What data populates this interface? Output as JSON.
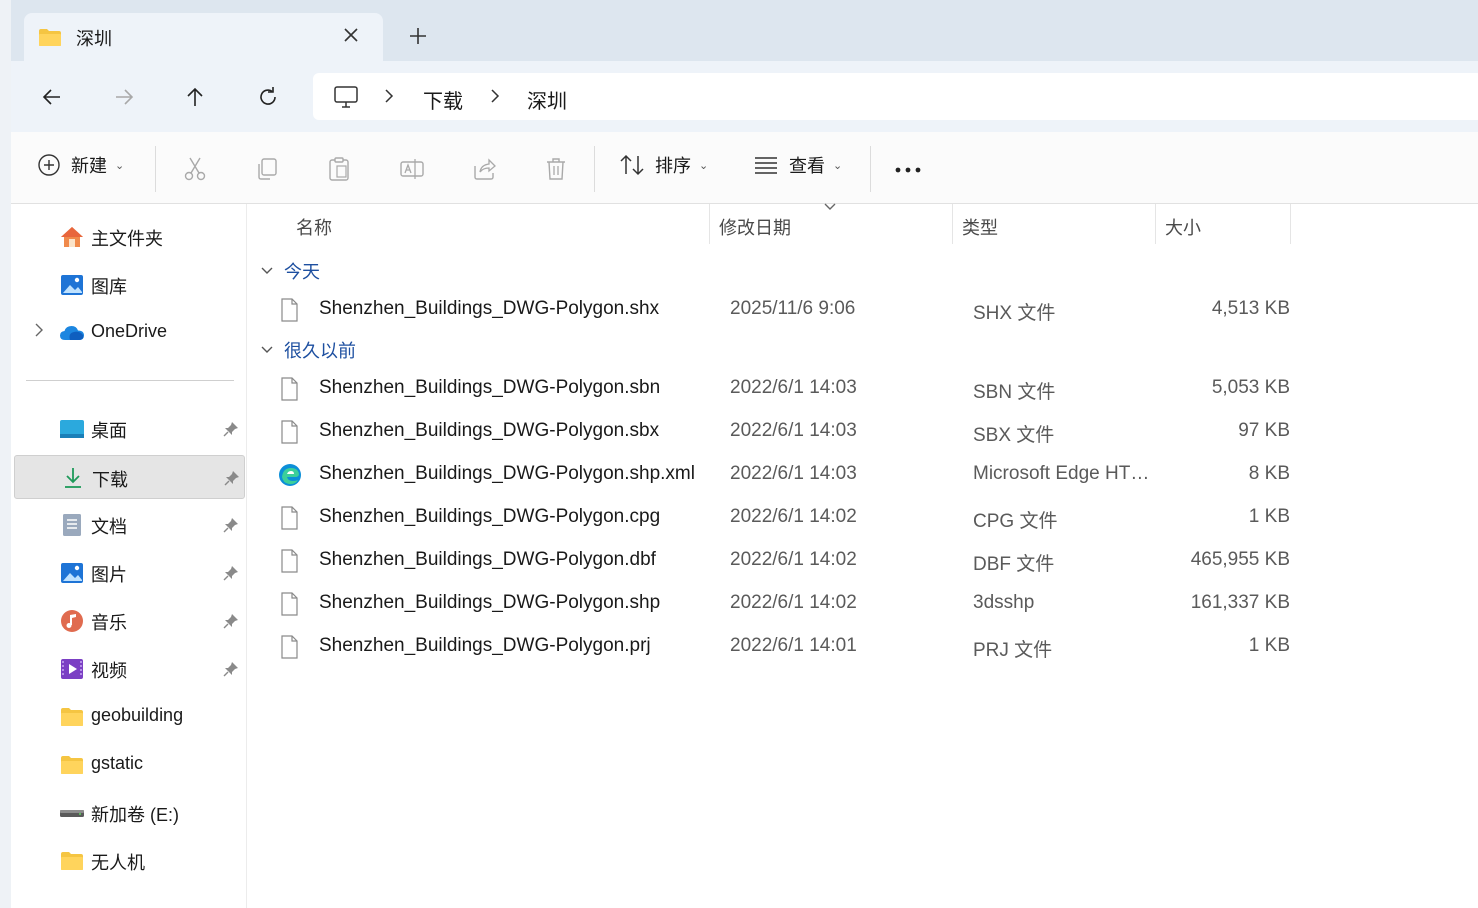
{
  "tab": {
    "title": "深圳",
    "close_icon": "close-icon",
    "new_tab_icon": "plus-icon"
  },
  "nav": {
    "breadcrumb": [
      "下载",
      "深圳"
    ]
  },
  "toolbar": {
    "new_label": "新建",
    "sort_label": "排序",
    "view_label": "查看"
  },
  "sidebar": {
    "items": [
      {
        "label": "主文件夹",
        "icon": "home-icon"
      },
      {
        "label": "图库",
        "icon": "gallery-icon"
      },
      {
        "label": "OneDrive",
        "icon": "cloud-icon"
      },
      {
        "label": "桌面",
        "icon": "desktop-icon"
      },
      {
        "label": "下载",
        "icon": "download-icon"
      },
      {
        "label": "文档",
        "icon": "document-icon"
      },
      {
        "label": "图片",
        "icon": "pictures-icon"
      },
      {
        "label": "音乐",
        "icon": "music-icon"
      },
      {
        "label": "视频",
        "icon": "video-icon"
      },
      {
        "label": "geobuilding",
        "icon": "folder-icon"
      },
      {
        "label": "gstatic",
        "icon": "folder-icon"
      },
      {
        "label": "新加卷 (E:)",
        "icon": "drive-icon"
      },
      {
        "label": "无人机",
        "icon": "folder-icon"
      }
    ]
  },
  "columns": {
    "name": "名称",
    "date": "修改日期",
    "type": "类型",
    "size": "大小"
  },
  "groups": [
    {
      "label": "今天",
      "files": [
        {
          "name": "Shenzhen_Buildings_DWG-Polygon.shx",
          "date": "2025/11/6 9:06",
          "type": "SHX 文件",
          "size": "4,513 KB",
          "icon": "file-icon"
        }
      ]
    },
    {
      "label": "很久以前",
      "files": [
        {
          "name": "Shenzhen_Buildings_DWG-Polygon.sbn",
          "date": "2022/6/1 14:03",
          "type": "SBN 文件",
          "size": "5,053 KB",
          "icon": "file-icon"
        },
        {
          "name": "Shenzhen_Buildings_DWG-Polygon.sbx",
          "date": "2022/6/1 14:03",
          "type": "SBX 文件",
          "size": "97 KB",
          "icon": "file-icon"
        },
        {
          "name": "Shenzhen_Buildings_DWG-Polygon.shp.xml",
          "date": "2022/6/1 14:03",
          "type": "Microsoft Edge HT…",
          "size": "8 KB",
          "icon": "edge-icon"
        },
        {
          "name": "Shenzhen_Buildings_DWG-Polygon.cpg",
          "date": "2022/6/1 14:02",
          "type": "CPG 文件",
          "size": "1 KB",
          "icon": "file-icon"
        },
        {
          "name": "Shenzhen_Buildings_DWG-Polygon.dbf",
          "date": "2022/6/1 14:02",
          "type": "DBF 文件",
          "size": "465,955 KB",
          "icon": "file-icon"
        },
        {
          "name": "Shenzhen_Buildings_DWG-Polygon.shp",
          "date": "2022/6/1 14:02",
          "type": "3dsshp",
          "size": "161,337 KB",
          "icon": "file-icon"
        },
        {
          "name": "Shenzhen_Buildings_DWG-Polygon.prj",
          "date": "2022/6/1 14:01",
          "type": "PRJ 文件",
          "size": "1 KB",
          "icon": "file-icon"
        }
      ]
    }
  ],
  "colors": {
    "accent": "#1d4fa0",
    "folder": "#f5c542",
    "selected": "#e5e5e5"
  }
}
